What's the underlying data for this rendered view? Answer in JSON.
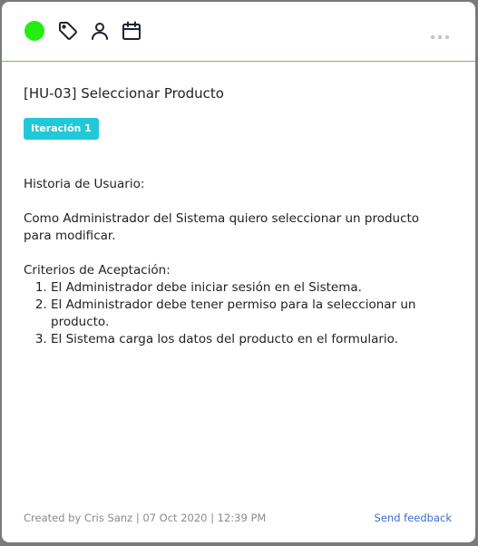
{
  "toolbar": {
    "status_color": "#22ee11",
    "icons": [
      "tag-icon",
      "user-icon",
      "calendar-icon",
      "more-icon"
    ]
  },
  "card": {
    "title": "[HU-03] Seleccionar Producto",
    "badge": "Iteración 1",
    "badge_color": "#21c8d8",
    "description": {
      "heading": "Historia de Usuario:",
      "story": "Como Administrador del Sistema quiero seleccionar un producto para modificar.",
      "criteria_heading": "Criterios de Aceptación:",
      "criteria": [
        "El Administrador debe iniciar sesión en el Sistema.",
        "El Administrador debe tener permiso para la seleccionar un producto.",
        "El Sistema carga los datos del producto en el formulario."
      ]
    }
  },
  "footer": {
    "meta": "Created by Cris Sanz | 07 Oct 2020 | 12:39 PM",
    "feedback_label": "Send feedback"
  }
}
